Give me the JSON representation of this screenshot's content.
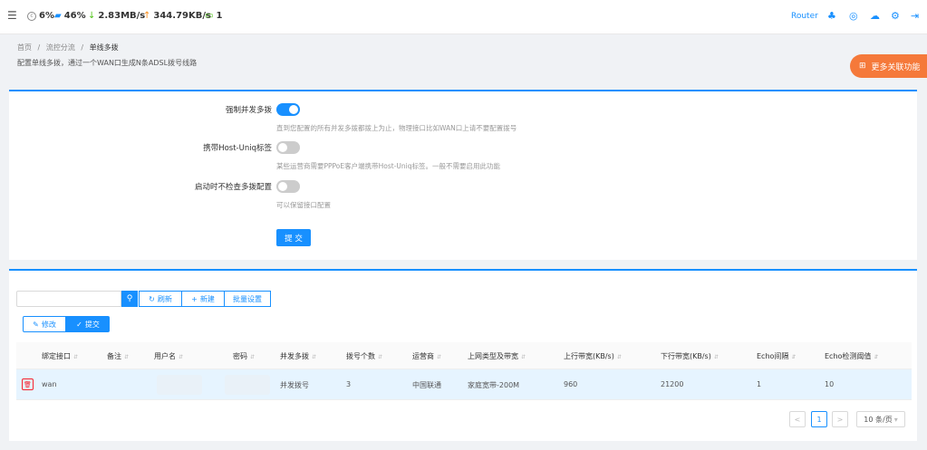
{
  "topbar": {
    "cpu": "6%",
    "mem": "46%",
    "down": "2.83MB/s",
    "up": "344.79KB/s",
    "devices": "1",
    "router": "Router"
  },
  "breadcrumb": [
    "首页",
    "/",
    "流控分流",
    "/",
    "单线多拨"
  ],
  "subtitle": "配置单线多拨，通过一个WAN口生成N条ADSL拨号线路",
  "more_label": "更多关联功能",
  "form": {
    "force_label": "强制并发多拨",
    "force_hint": "直到您配置的所有并发多拨都拨上为止，物理接口比如WAN口上请不要配置拨号",
    "force_on": true,
    "hostuniq_label": "携带Host-Uniq标签",
    "hostuniq_hint": "某些运营商需要PPPoE客户端携带Host-Uniq标签。一般不需要启用此功能",
    "hostuniq_on": false,
    "nocheck_label": "启动时不检查多拨配置",
    "nocheck_hint": "可以保留接口配置",
    "nocheck_on": false,
    "submit_label": "提 交"
  },
  "toolbar": {
    "search_placeholder": "",
    "refresh_label": "刷新",
    "new_label": "新建",
    "batch_label": "批量设置",
    "edit_label": "修改",
    "submit_label": "提交"
  },
  "table": {
    "headers": [
      "绑定接口",
      "备注",
      "用户名",
      "密码",
      "并发多拨",
      "拨号个数",
      "运营商",
      "上网类型及带宽",
      "上行带宽(KB/s)",
      "下行带宽(KB/s)",
      "Echo间隔",
      "Echo检测阈值"
    ],
    "rows": [
      {
        "iface": "wan",
        "remark": "",
        "username": "",
        "password": "",
        "mode": "并发拨号",
        "count": "3",
        "isp": "中国联通",
        "type": "家庭宽带-200M",
        "up": "960",
        "down": "21200",
        "echo_interval": "1",
        "echo_threshold": "10"
      }
    ]
  },
  "pagination": {
    "prev": "<",
    "page": "1",
    "next": ">",
    "size": "10 条/页"
  }
}
